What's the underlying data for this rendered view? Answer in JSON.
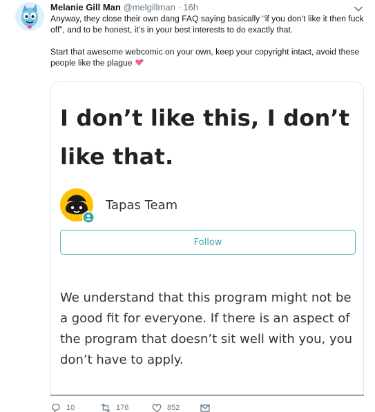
{
  "tweet": {
    "author": {
      "display_name": "Melanie Gill Man",
      "handle": "@melgillman",
      "separator": "·",
      "time": "16h"
    },
    "paragraphs": [
      "Anyway, they close their own dang FAQ saying basically “if you don’t like it then fuck off”, and to be honest, it’s in your best interests to do exactly that.",
      "Start that awesome webcomic on your own, keep your copyright intact, avoid these people like the plague"
    ],
    "emoji": "two-hearts"
  },
  "card": {
    "title": "I don’t like this, I don’t like that.",
    "author_name": "Tapas Team",
    "follow_label": "Follow",
    "body": "We understand that this program might not be a good fit for everyone. If there is an aspect of the program that doesn’t sit well with you, you don’t have to apply.",
    "accent_color": "#4fb9bc"
  },
  "actions": {
    "reply_count": "10",
    "retweet_count": "176",
    "like_count": "852"
  },
  "icons": [
    "fish-mascot-avatar",
    "chevron-down-icon",
    "two-hearts-emoji",
    "tapas-mascot-avatar",
    "verified-person-icon",
    "reply-icon",
    "retweet-icon",
    "like-icon",
    "message-icon"
  ]
}
